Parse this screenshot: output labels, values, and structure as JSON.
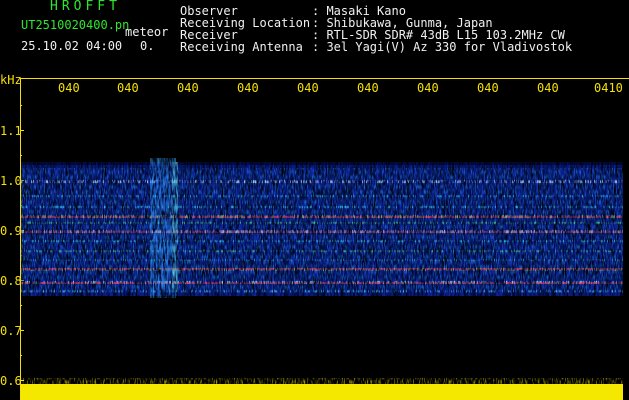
{
  "header": {
    "title": "HROFFT",
    "filename": "UT2510020400.pn",
    "meteor_label": "meteor",
    "datetime": "25.10.02 04:00",
    "meteor_count": "0.",
    "observer_label": "Observer",
    "observer": ": Masaki Kano",
    "location_label": "Receiving Location",
    "location": ": Shibukawa, Gunma, Japan",
    "receiver_label": "Receiver",
    "receiver": ": RTL-SDR SDR# 43dB L15 103.2MHz CW",
    "antenna_label": "Receiving Antenna",
    "antenna": ": 3el Yagi(V) Az 330 for Vladivostok"
  },
  "axis": {
    "y_unit": "kHz",
    "y_ticks": [
      "1.1",
      "1.0",
      "0.9",
      "0.8",
      "0.7",
      "0.6"
    ],
    "x_ticks": [
      "040",
      "040",
      "040",
      "040",
      "040",
      "040",
      "040",
      "040",
      "040",
      "0410"
    ]
  },
  "colors": {
    "background": "#000000",
    "header_green": "#2ee62e",
    "header_white": "#f0f0f0",
    "axis_yellow": "#f5e000",
    "noise_yellow": "#f5e800"
  }
}
